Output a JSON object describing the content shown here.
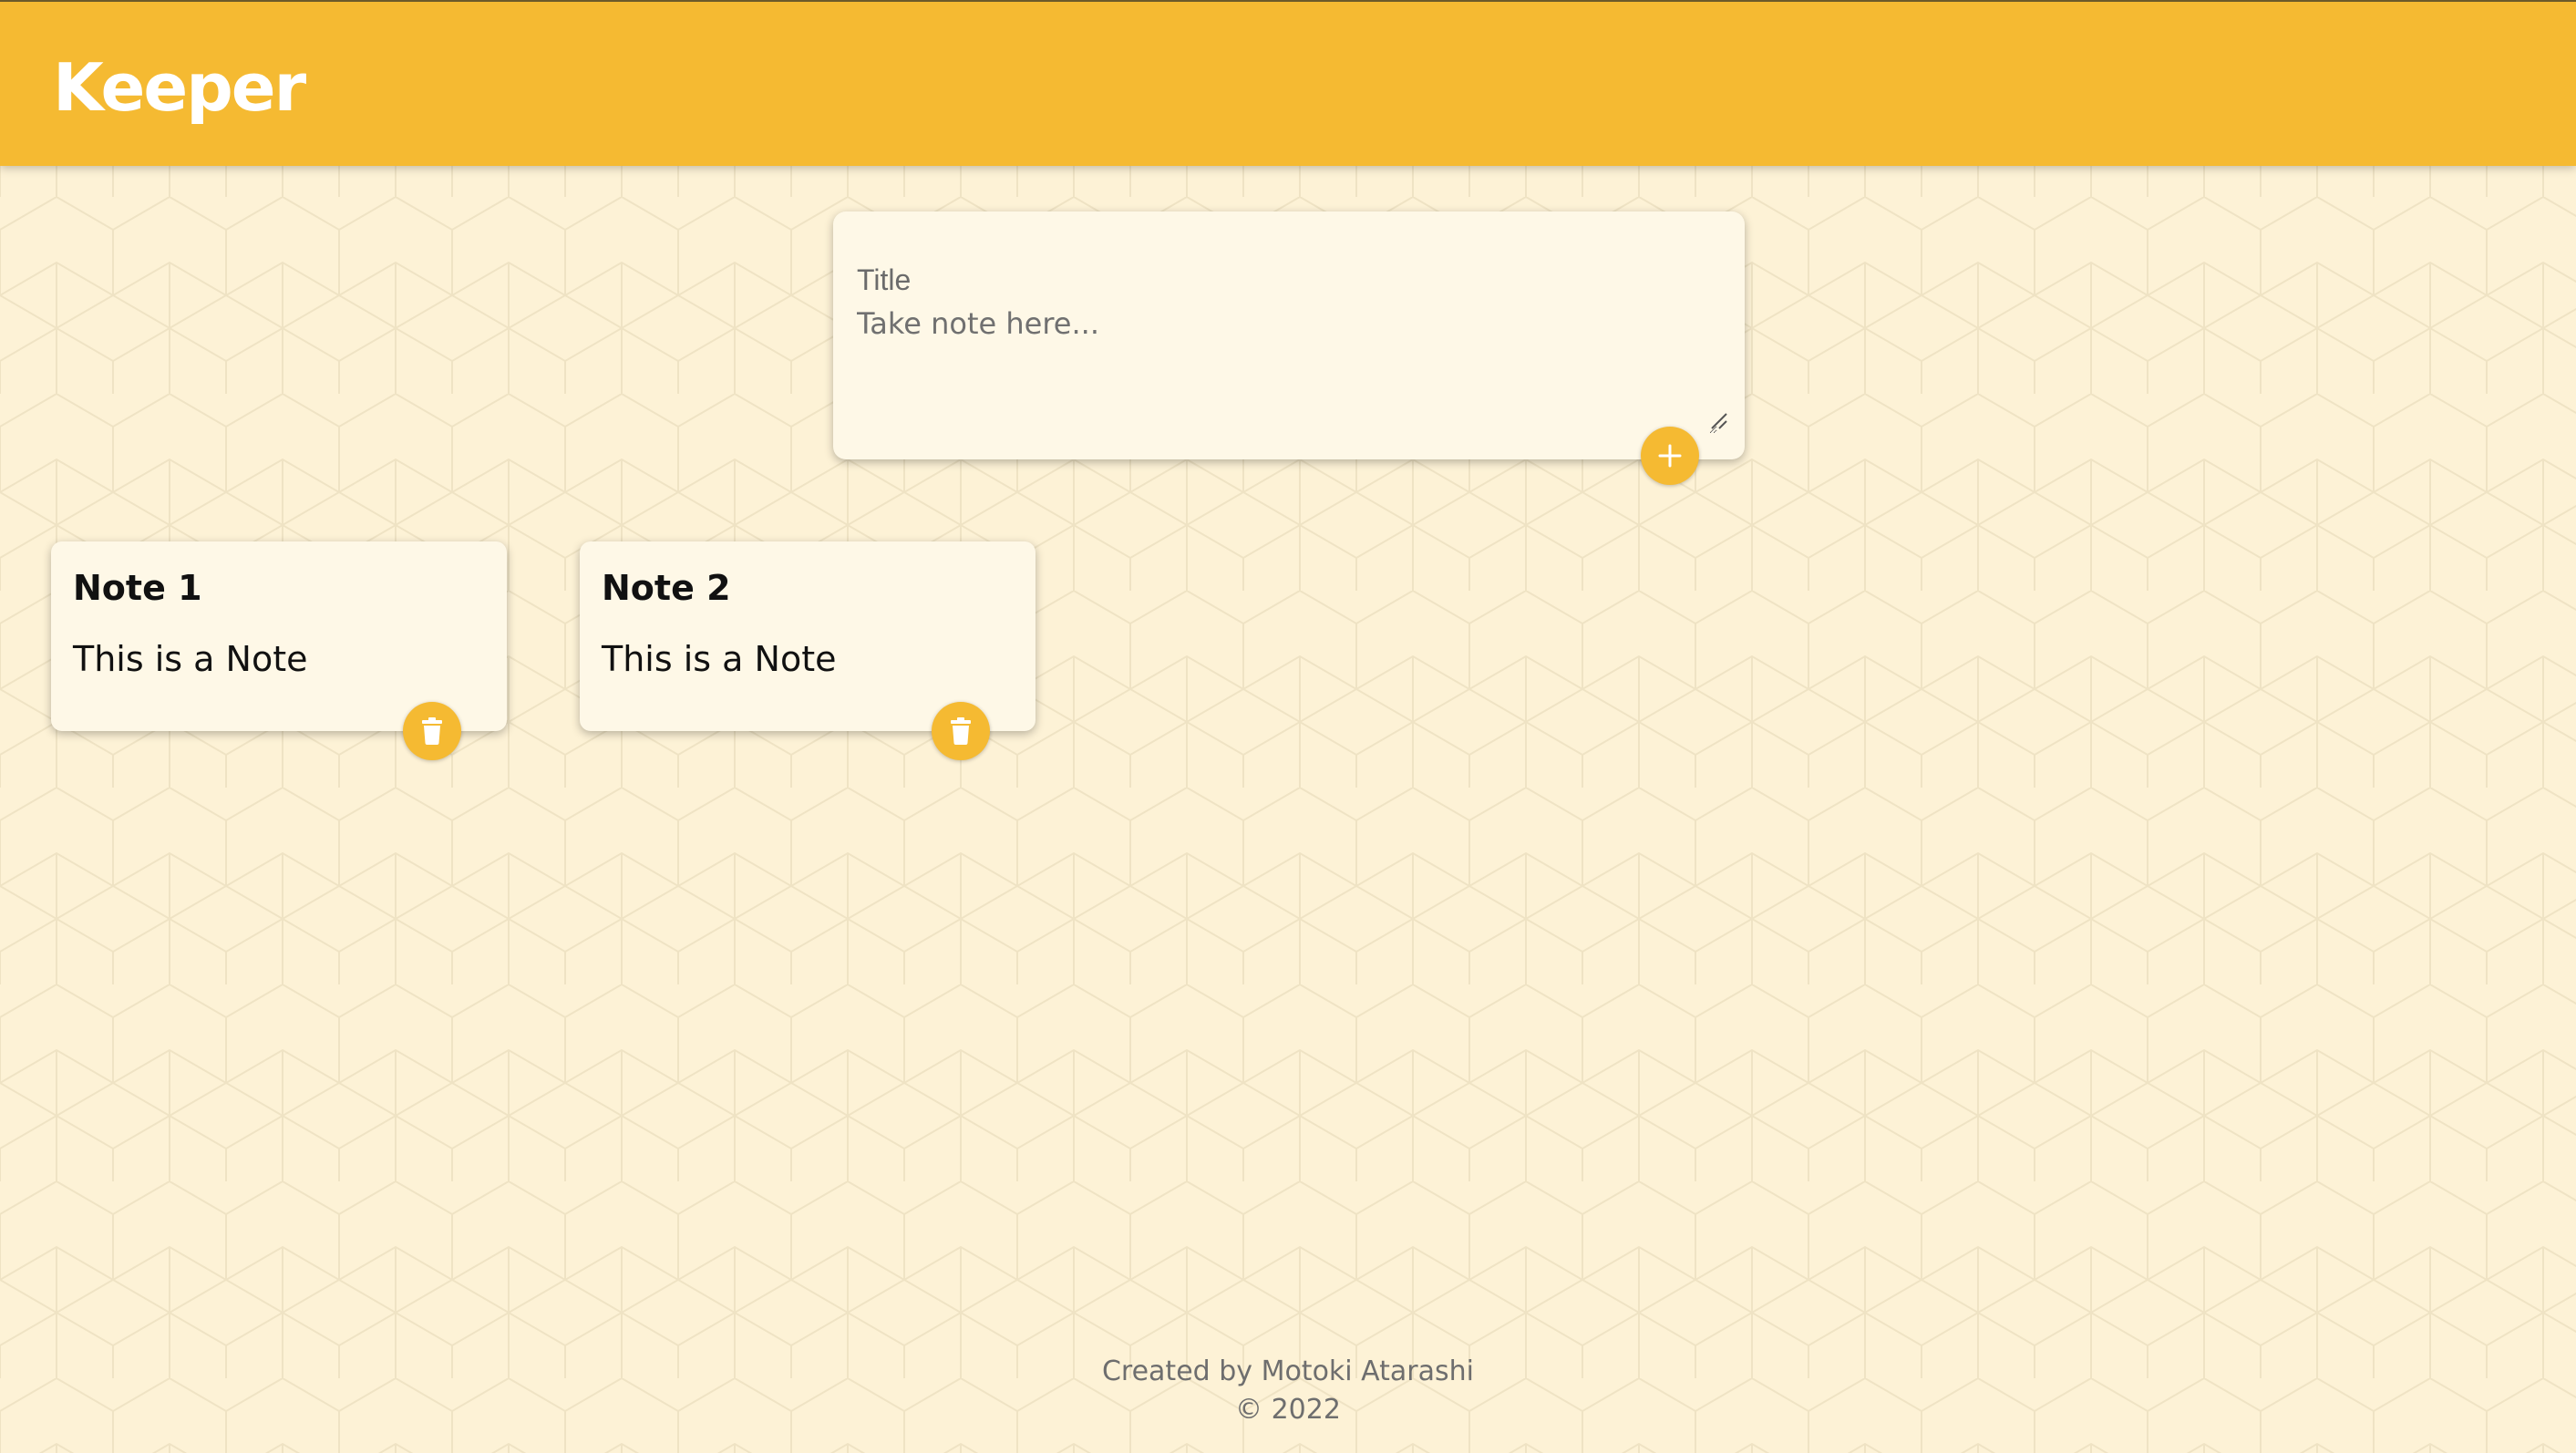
{
  "app": {
    "name": "Keeper"
  },
  "colors": {
    "accent": "#f5ba32",
    "background": "#fdf2d6",
    "card": "#fef8e7",
    "pattern_line": "#efe3c4"
  },
  "create_form": {
    "title_placeholder": "Title",
    "content_placeholder": "Take note here...",
    "add_icon": "plus-icon"
  },
  "notes": [
    {
      "title": "Note 1",
      "content": "This is a Note",
      "delete_icon": "trash-icon"
    },
    {
      "title": "Note 2",
      "content": "This is a Note",
      "delete_icon": "trash-icon"
    }
  ],
  "footer": {
    "credit": "Created by Motoki Atarashi",
    "copyright": "© 2022"
  }
}
